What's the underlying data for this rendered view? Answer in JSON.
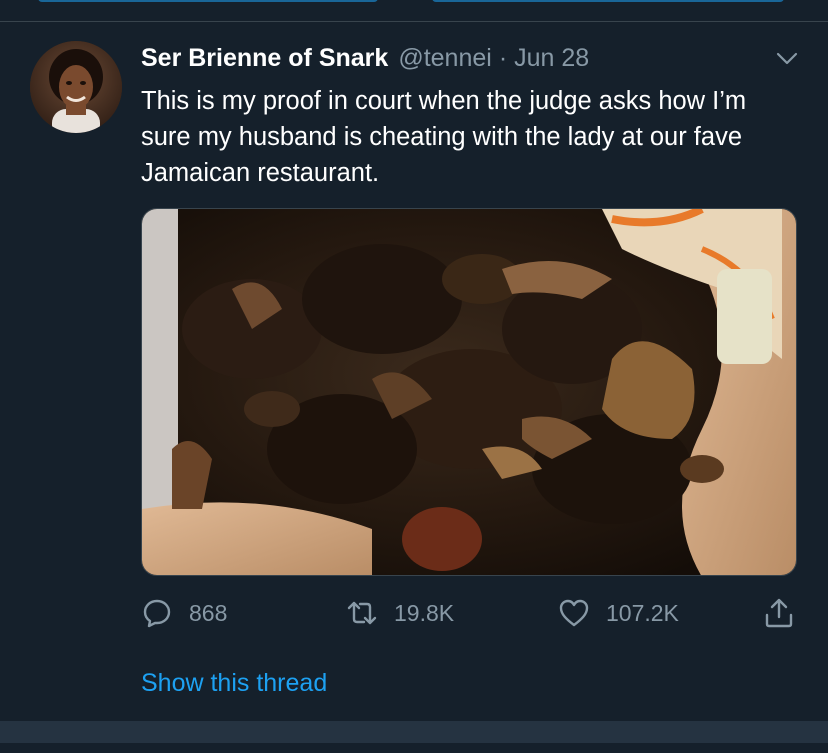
{
  "tweet": {
    "display_name": "Ser Brienne of Snark",
    "handle": "@tennei",
    "separator": "·",
    "date": "Jun 28",
    "text": "This is my proof in court when the judge asks how I’m sure my husband is cheating with the lady at our fave Jamaican restaurant.",
    "media_icon": "photo-of-oxtail-and-rice-and-peas",
    "actions": {
      "reply_count": "868",
      "retweet_count": "19.8K",
      "like_count": "107.2K"
    },
    "show_thread": "Show this thread"
  },
  "icons": {
    "caret": "chevron-down-icon",
    "reply": "reply-icon",
    "retweet": "retweet-icon",
    "like": "heart-icon",
    "share": "share-icon"
  },
  "colors": {
    "background": "#15202b",
    "text_primary": "#ffffff",
    "text_secondary": "#8899a6",
    "accent": "#1da1f2",
    "divider": "#38444d"
  }
}
